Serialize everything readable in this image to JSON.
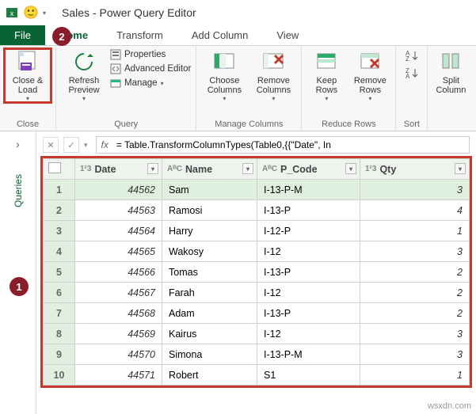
{
  "window": {
    "title": "Sales - Power Query Editor"
  },
  "tabs": {
    "file": "File",
    "home": "Home",
    "transform": "Transform",
    "addcol": "Add Column",
    "view": "View"
  },
  "ribbon": {
    "close": {
      "label": "Close &\nLoad",
      "group": "Close"
    },
    "refresh": {
      "label": "Refresh\nPreview",
      "props": "Properties",
      "adv": "Advanced Editor",
      "manage": "Manage",
      "group": "Query"
    },
    "choose": {
      "label": "Choose\nColumns"
    },
    "remove": {
      "label": "Remove\nColumns"
    },
    "manageCols": "Manage Columns",
    "keep": {
      "label": "Keep\nRows"
    },
    "removeRows": {
      "label": "Remove\nRows"
    },
    "reduce": "Reduce Rows",
    "sort": "Sort",
    "split": {
      "label": "Split\nColumn"
    }
  },
  "side": {
    "queries": "Queries",
    "expand": "›"
  },
  "fx": {
    "formula": "= Table.TransformColumnTypes(Table0,{{\"Date\", In"
  },
  "callouts": {
    "one": "1",
    "two": "2"
  },
  "columns": {
    "date": "Date",
    "name": "Name",
    "pcode": "P_Code",
    "qty": "Qty",
    "t_num": "1²3",
    "t_txt": "AᴮC"
  },
  "rows": [
    {
      "n": "1",
      "date": "44562",
      "name": "Sam",
      "pcode": "I-13-P-M",
      "qty": "3"
    },
    {
      "n": "2",
      "date": "44563",
      "name": "Ramosi",
      "pcode": "I-13-P",
      "qty": "4"
    },
    {
      "n": "3",
      "date": "44564",
      "name": "Harry",
      "pcode": "I-12-P",
      "qty": "1"
    },
    {
      "n": "4",
      "date": "44565",
      "name": "Wakosy",
      "pcode": "I-12",
      "qty": "3"
    },
    {
      "n": "5",
      "date": "44566",
      "name": "Tomas",
      "pcode": "I-13-P",
      "qty": "2"
    },
    {
      "n": "6",
      "date": "44567",
      "name": "Farah",
      "pcode": "I-12",
      "qty": "2"
    },
    {
      "n": "7",
      "date": "44568",
      "name": "Adam",
      "pcode": "I-13-P",
      "qty": "2"
    },
    {
      "n": "8",
      "date": "44569",
      "name": "Kairus",
      "pcode": "I-12",
      "qty": "3"
    },
    {
      "n": "9",
      "date": "44570",
      "name": "Simona",
      "pcode": "I-13-P-M",
      "qty": "3"
    },
    {
      "n": "10",
      "date": "44571",
      "name": "Robert",
      "pcode": "S1",
      "qty": "1"
    }
  ],
  "watermark": "wsxdn.com"
}
